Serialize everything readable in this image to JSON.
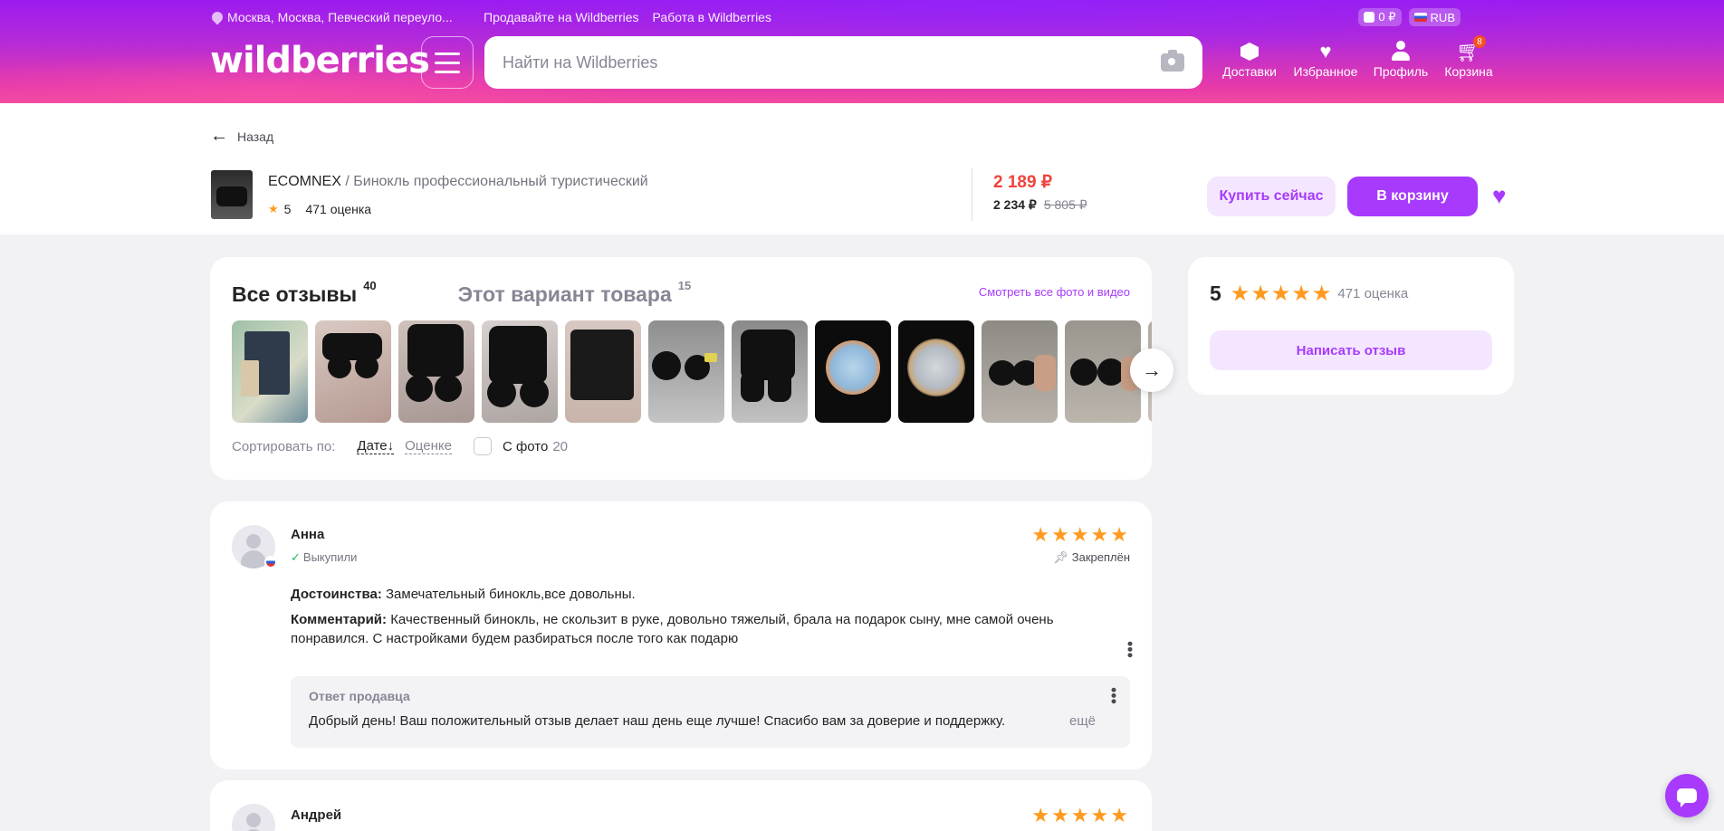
{
  "header": {
    "location": "Москва, Москва, Певческий переуло...",
    "sell_link": "Продавайте на Wildberries",
    "work_link": "Работа в Wildberries",
    "balance": "0 ₽",
    "currency": "RUB",
    "logo": "wildberries",
    "search_placeholder": "Найти на Wildberries",
    "nav": {
      "delivery": "Доставки",
      "favorites": "Избранное",
      "profile": "Профиль",
      "cart": "Корзина",
      "cart_count": "8"
    }
  },
  "product": {
    "back_label": "Назад",
    "brand": "ECOMNEX",
    "separator": " / ",
    "name": "Бинокль профессиональный туристический",
    "rating": "5",
    "ratings_count": "471 оценка",
    "price_current": "2 189 ₽",
    "price_wallet": "2 234 ₽",
    "price_old": "5 805 ₽",
    "buy_now_label": "Купить сейчас",
    "add_to_cart_label": "В корзину"
  },
  "reviews": {
    "tab_all_label": "Все отзывы",
    "tab_all_count": "40",
    "tab_variant_label": "Этот вариант товара",
    "tab_variant_count": "15",
    "all_media_link": "Смотреть все фото и видео",
    "sort_label": "Сортировать по:",
    "sort_date": "Дате↓",
    "sort_rating": "Оценке",
    "with_photo_label": "С фото",
    "with_photo_count": "20"
  },
  "summary": {
    "rating": "5",
    "stars": "★★★★★",
    "count": "471 оценка",
    "write_review_label": "Написать отзыв"
  },
  "review_list": [
    {
      "author": "Анна",
      "bought_label": "Выкупили",
      "stars": "★★★★★",
      "pinned_label": "Закреплён",
      "pros_label": "Достоинства:",
      "pros_text": "Замечательный бинокль,все довольны.",
      "comment_label": "Комментарий:",
      "comment_text": "Качественный бинокль, не скользит в руке, довольно тяжелый, брала на подарок сыну, мне самой очень понравился. С настройками будем разбираться после того как подарю",
      "reply_title": "Ответ продавца",
      "reply_text": "Добрый день! Ваш положительный отзыв делает наш день еще лучше! Спасибо вам за доверие и поддержку.",
      "reply_more": "ещё"
    },
    {
      "author": "Андрей",
      "stars": "★★★★★"
    }
  ],
  "colors": {
    "accent": "#a73afd",
    "price": "#f0433c",
    "star": "#ff9a1f"
  }
}
